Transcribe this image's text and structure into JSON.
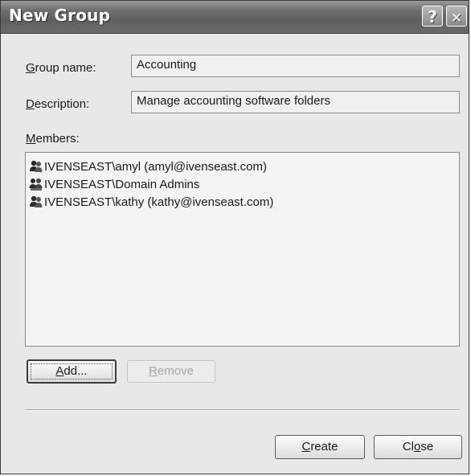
{
  "window": {
    "title": "New Group",
    "help_glyph": "?",
    "close_glyph": "✕"
  },
  "form": {
    "group_name_label": "Group name:",
    "group_name_value": "Accounting",
    "description_label": "Description:",
    "description_value": "Manage accounting software folders",
    "members_label": "Members:"
  },
  "members": [
    {
      "text": "IVENSEAST\\amyl (amyl@ivenseast.com)",
      "icon": "user-icon"
    },
    {
      "text": "IVENSEAST\\Domain Admins",
      "icon": "group-icon"
    },
    {
      "text": "IVENSEAST\\kathy (kathy@ivenseast.com)",
      "icon": "user-icon"
    }
  ],
  "buttons": {
    "add": "Add...",
    "remove": "Remove",
    "create": "Create",
    "close": "Close"
  }
}
